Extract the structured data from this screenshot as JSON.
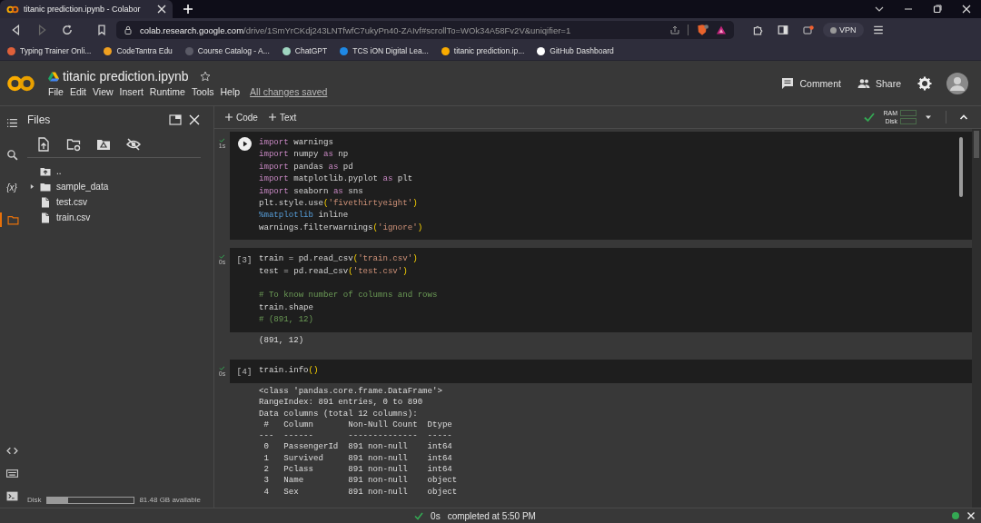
{
  "browser": {
    "tab": {
      "title": "titanic prediction.ipynb - Colabor"
    },
    "url": {
      "host": "colab.research.google.com",
      "path": "/drive/1SmYrCKdj243LNTfwfC7ukyPn40-ZAIvf#scrollTo=WOk34A58Fv2V&uniqifier=1"
    },
    "vpn": "VPN",
    "bookmarks": [
      {
        "label": "Typing Trainer Onli...",
        "color": "#e0603a"
      },
      {
        "label": "CodeTantra Edu",
        "color": "#f0a020"
      },
      {
        "label": "Course Catalog - A...",
        "color": "#5a5a66"
      },
      {
        "label": "ChatGPT",
        "color": "#9fd5c0"
      },
      {
        "label": "TCS iON Digital Lea...",
        "color": "#1e88e5"
      },
      {
        "label": "titanic prediction.ip...",
        "color": "#f9ab00"
      },
      {
        "label": "GitHub Dashboard",
        "color": "#ffffff"
      }
    ]
  },
  "notebook": {
    "title": "titanic prediction.ipynb",
    "menu": [
      "File",
      "Edit",
      "View",
      "Insert",
      "Runtime",
      "Tools",
      "Help"
    ],
    "save_status": "All changes saved",
    "actions": [
      {
        "label": "Comment",
        "kind": "comment"
      },
      {
        "label": "Share",
        "kind": "share"
      }
    ]
  },
  "rail": {
    "top": [
      {
        "kind": "search",
        "selected": false
      },
      {
        "kind": "variables",
        "glyph": "{x}",
        "selected": false
      },
      {
        "kind": "files",
        "selected": true
      }
    ],
    "bottom": [
      {
        "kind": "code"
      },
      {
        "kind": "keyboard"
      },
      {
        "kind": "terminal"
      }
    ]
  },
  "sidebar": {
    "title": "Files",
    "files": [
      {
        "name": "..",
        "kind": "up"
      },
      {
        "name": "sample_data",
        "kind": "folder"
      },
      {
        "name": "test.csv",
        "kind": "file"
      },
      {
        "name": "train.csv",
        "kind": "file"
      }
    ],
    "disk": {
      "label": "Disk",
      "level": 0.24,
      "reading": "81.48 GB available"
    }
  },
  "toolbar": {
    "add": [
      "Code",
      "Text"
    ],
    "resources": [
      "RAM",
      "Disk"
    ]
  },
  "cells": [
    {
      "time": "1s",
      "lines": [
        {
          "tokens": [
            {
              "text": "import",
              "kind": "kw"
            },
            {
              "text": " warnings",
              "kind": "plain"
            }
          ]
        },
        {
          "tokens": [
            {
              "text": "import",
              "kind": "kw"
            },
            {
              "text": " numpy ",
              "kind": "plain"
            },
            {
              "text": "as",
              "kind": "kw"
            },
            {
              "text": " np",
              "kind": "plain"
            }
          ]
        },
        {
          "tokens": [
            {
              "text": "import",
              "kind": "kw"
            },
            {
              "text": " pandas ",
              "kind": "plain"
            },
            {
              "text": "as",
              "kind": "kw"
            },
            {
              "text": " pd",
              "kind": "plain"
            }
          ]
        },
        {
          "tokens": [
            {
              "text": "import",
              "kind": "kw"
            },
            {
              "text": " matplotlib.pyplot ",
              "kind": "plain"
            },
            {
              "text": "as",
              "kind": "kw"
            },
            {
              "text": " plt",
              "kind": "plain"
            }
          ]
        },
        {
          "tokens": [
            {
              "text": "import",
              "kind": "kw"
            },
            {
              "text": " seaborn ",
              "kind": "plain"
            },
            {
              "text": "as",
              "kind": "kw"
            },
            {
              "text": " sns",
              "kind": "plain"
            }
          ]
        },
        {
          "tokens": [
            {
              "text": "plt.style.use",
              "kind": "plain"
            },
            {
              "text": "(",
              "kind": "br"
            },
            {
              "text": "'fivethirtyeight'",
              "kind": "str"
            },
            {
              "text": ")",
              "kind": "br"
            }
          ]
        },
        {
          "tokens": [
            {
              "text": "%matplotlib",
              "kind": "magic"
            },
            {
              "text": " inline",
              "kind": "plain"
            }
          ]
        },
        {
          "tokens": [
            {
              "text": "warnings.filterwarnings",
              "kind": "plain"
            },
            {
              "text": "(",
              "kind": "br"
            },
            {
              "text": "'ignore'",
              "kind": "str"
            },
            {
              "text": ")",
              "kind": "br"
            }
          ]
        }
      ]
    },
    {
      "label": "[3]",
      "time": "0s",
      "lines": [
        {
          "tokens": [
            {
              "text": "train = pd.read_csv",
              "kind": "plain"
            },
            {
              "text": "(",
              "kind": "br"
            },
            {
              "text": "'train.csv'",
              "kind": "str"
            },
            {
              "text": ")",
              "kind": "br"
            }
          ]
        },
        {
          "tokens": [
            {
              "text": "test = pd.read_csv",
              "kind": "plain"
            },
            {
              "text": "(",
              "kind": "br"
            },
            {
              "text": "'test.csv'",
              "kind": "str"
            },
            {
              "text": ")",
              "kind": "br"
            }
          ]
        },
        {
          "gap_before": true,
          "tokens": [
            {
              "text": "# To know number of columns and rows",
              "kind": "cmt"
            }
          ]
        },
        {
          "tokens": [
            {
              "text": "train.shape",
              "kind": "plain"
            }
          ]
        },
        {
          "tokens": [
            {
              "text": "# (891, 12)",
              "kind": "cmt"
            }
          ]
        }
      ],
      "output": [
        "(891, 12)"
      ]
    },
    {
      "label": "[4]",
      "time": "0s",
      "lines": [
        {
          "tokens": [
            {
              "text": "train.info",
              "kind": "plain"
            },
            {
              "text": "()",
              "kind": "br"
            }
          ]
        }
      ],
      "output": [
        "<class 'pandas.core.frame.DataFrame'>",
        "RangeIndex: 891 entries, 0 to 890",
        "Data columns (total 12 columns):",
        " #   Column       Non-Null Count  Dtype",
        "---  ------       --------------  -----",
        " 0   PassengerId  891 non-null    int64",
        " 1   Survived     891 non-null    int64",
        " 2   Pclass       891 non-null    int64",
        " 3   Name         891 non-null    object",
        " 4   Sex          891 non-null    object"
      ]
    }
  ],
  "status": {
    "time": "0s",
    "message": "completed at 5:50 PM"
  }
}
